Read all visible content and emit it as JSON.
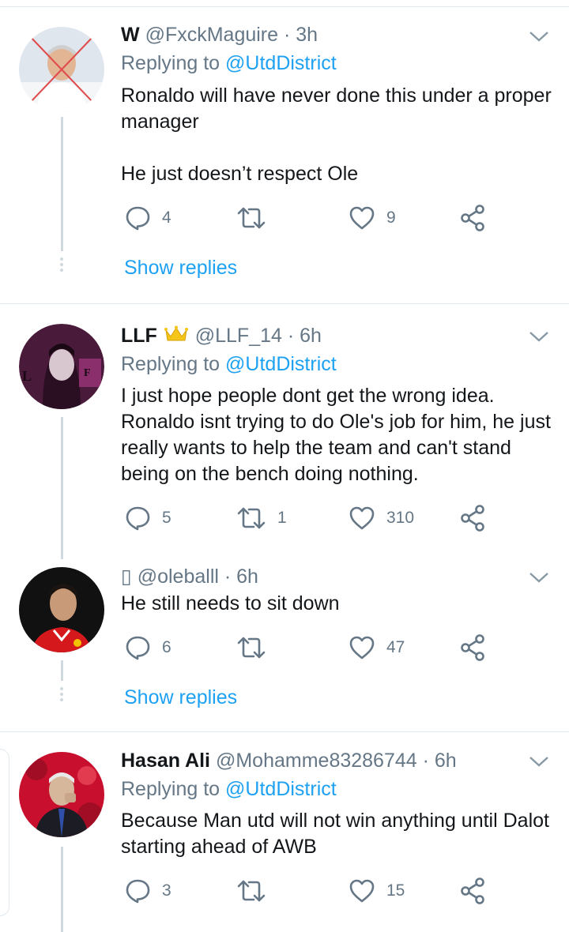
{
  "tweets": [
    {
      "name": "W",
      "handle": "@FxckMaguire",
      "time": "3h",
      "reply_prefix": "Replying to ",
      "reply_to": "@UtdDistrict",
      "text": "Ronaldo will have never done this under a proper manager\n\nHe just doesn’t respect Ole",
      "replies": "4",
      "retweets": "",
      "likes": "9",
      "show_replies": "Show replies"
    },
    {
      "name": "LLF",
      "name_badge_icon": "crown-icon",
      "handle": "@LLF_14",
      "time": "6h",
      "reply_prefix": "Replying to ",
      "reply_to": "@UtdDistrict",
      "text": "I just hope people dont get the wrong idea. Ronaldo isnt trying to do Ole's job for him, he just really wants to help the team and can't stand being on the bench doing nothing.",
      "replies": "5",
      "retweets": "1",
      "likes": "310"
    },
    {
      "name": "",
      "handle": "@oleballl",
      "time": "6h",
      "text": "He still needs to sit down",
      "replies": "6",
      "retweets": "",
      "likes": "47",
      "show_replies": "Show replies"
    },
    {
      "name": "Hasan Ali",
      "handle": "@Mohamme83286744",
      "time": "6h",
      "reply_prefix": "Replying to ",
      "reply_to": "@UtdDistrict",
      "text": "Because Man utd will not win anything until Dalot starting ahead of AWB",
      "replies": "3",
      "retweets": "",
      "likes": "15"
    }
  ],
  "header_separator": " · ",
  "unknown_glyph": "▯",
  "colors": {
    "link": "#1da1f2",
    "muted": "#657786",
    "text": "#14171a",
    "divider": "#e1e8ed",
    "thread": "#cfd9de"
  },
  "icons": {
    "reply": "reply-icon",
    "retweet": "retweet-icon",
    "like": "heart-icon",
    "share": "share-icon",
    "menu": "chevron-down-icon"
  }
}
